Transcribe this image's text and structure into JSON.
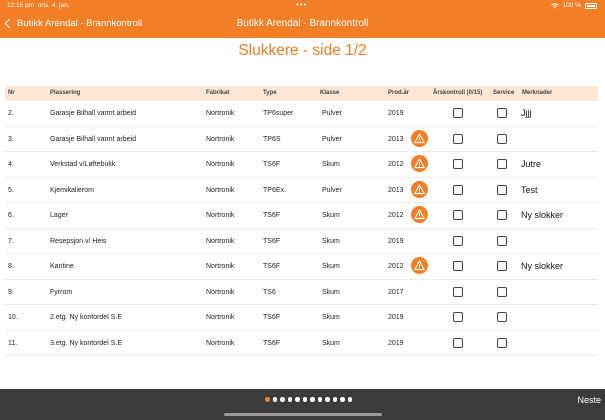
{
  "status": {
    "time": "12:15 pm",
    "date": "ons. 4. jan.",
    "dots": "•••",
    "battery": "100 %"
  },
  "nav": {
    "back_label": "Butikk Arendal - Brannkontroll",
    "title": "Butikk Arendal - Brannkontroll"
  },
  "page_title": "Slukkere - side 1/2",
  "columns": {
    "nr": "Nr",
    "plassering": "Plassering",
    "fabrikat": "Fabrikat",
    "type": "Type",
    "klasse": "Klasse",
    "prod": "Prod.år",
    "ars": "Årskontroll (0/15)",
    "service": "Service",
    "merknader": "Merknader"
  },
  "rows": [
    {
      "nr": "2.",
      "plassering": "Garasje Bilhall varmt arbeid",
      "fabrikat": "Nortronik",
      "type": "TP6super",
      "klasse": "Pulver",
      "prod": "2019",
      "warning": false,
      "merknad": "Jjjj"
    },
    {
      "nr": "3.",
      "plassering": "Garasje Bilhall varmt arbeid",
      "fabrikat": "Nortronik",
      "type": "TP6S",
      "klasse": "Pulver",
      "prod": "2013",
      "warning": true,
      "merknad": ""
    },
    {
      "nr": "4.",
      "plassering": "Verkstad  v/Løftebukk",
      "fabrikat": "Nortronik",
      "type": "TS6F",
      "klasse": "Skum",
      "prod": "2012",
      "warning": true,
      "merknad": "Jutre"
    },
    {
      "nr": "5.",
      "plassering": "Kjemikalierom",
      "fabrikat": "Nortronik",
      "type": "TP6Ex.",
      "klasse": "Pulver",
      "prod": "2013",
      "warning": true,
      "merknad": "Test"
    },
    {
      "nr": "6.",
      "plassering": "Lager",
      "fabrikat": "Nortronik",
      "type": "TS6F",
      "klasse": "Skum",
      "prod": "2012",
      "warning": true,
      "merknad": "Ny slokker"
    },
    {
      "nr": "7.",
      "plassering": "Resepsjon v/ Heis",
      "fabrikat": "Nortronik",
      "type": "TS6F",
      "klasse": "Skum",
      "prod": "2019",
      "warning": false,
      "merknad": ""
    },
    {
      "nr": "8.",
      "plassering": "Kantine",
      "fabrikat": "Nortronik",
      "type": "TS6F",
      "klasse": "Skum",
      "prod": "2012",
      "warning": true,
      "merknad": "Ny slokker"
    },
    {
      "nr": "9.",
      "plassering": "Fyrrom",
      "fabrikat": "Nortronik",
      "type": "TS6",
      "klasse": "Skum",
      "prod": "2017",
      "warning": false,
      "merknad": ""
    },
    {
      "nr": "10.",
      "plassering": "2.etg.   Ny kontordel S.E",
      "fabrikat": "Nortronik",
      "type": "TS6F",
      "klasse": "Skum",
      "prod": "2019",
      "warning": false,
      "merknad": ""
    },
    {
      "nr": "11.",
      "plassering": "3.etg.   Ny kontordel S.E",
      "fabrikat": "Nortronik",
      "type": "TS6F",
      "klasse": "Skum",
      "prod": "2019",
      "warning": false,
      "merknad": ""
    }
  ],
  "pagination": {
    "count": 12,
    "active_index": 0
  },
  "next_label": "Neste",
  "colors": {
    "accent": "#f27f25",
    "header_bg": "#fde7d4",
    "bottom_bar": "#3b3b3b"
  },
  "icons": {
    "back": "chevron-left-icon",
    "warning": "warning-triangle-icon",
    "wifi": "wifi-icon",
    "battery": "battery-icon"
  }
}
